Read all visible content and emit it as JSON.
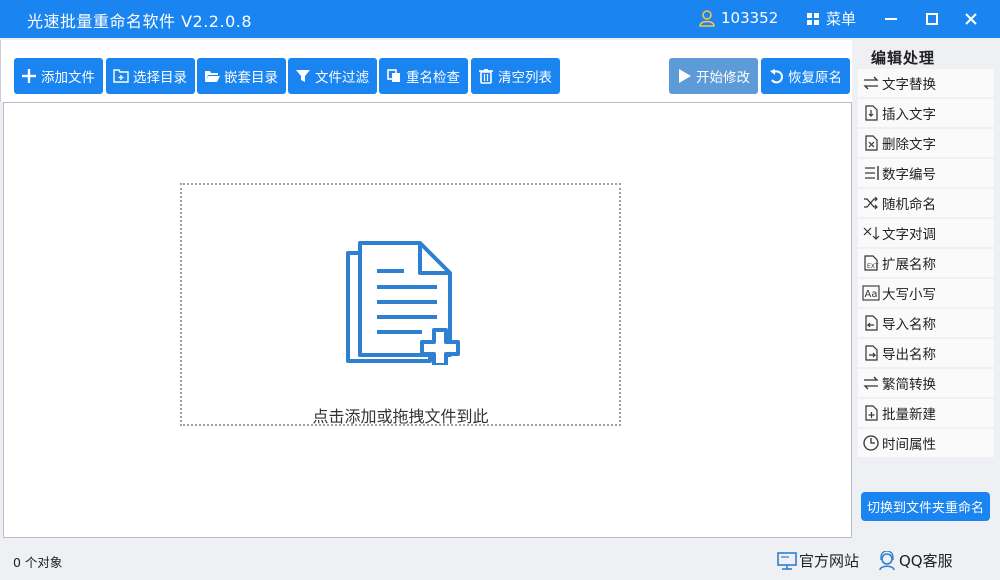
{
  "window": {
    "title": "光速批量重命名软件 V2.2.0.8",
    "user_id": "103352",
    "menu_label": "菜单"
  },
  "toolbar": {
    "add_files": "添加文件",
    "select_dir": "选择目录",
    "nested_dir": "嵌套目录",
    "file_filter": "文件过滤",
    "rename_check": "重名检查",
    "clear_list": "清空列表",
    "start_modify": "开始修改",
    "restore_name": "恢复原名"
  },
  "dropzone": {
    "text": "点击添加或拖拽文件到此"
  },
  "sidebar": {
    "title": "编辑处理",
    "items": [
      {
        "label": "文字替换",
        "icon": "swap-icon"
      },
      {
        "label": "插入文字",
        "icon": "insert-text-icon"
      },
      {
        "label": "删除文字",
        "icon": "delete-text-icon"
      },
      {
        "label": "数字编号",
        "icon": "numbering-icon"
      },
      {
        "label": "随机命名",
        "icon": "shuffle-icon"
      },
      {
        "label": "文字对调",
        "icon": "exchange-icon"
      },
      {
        "label": "扩展名称",
        "icon": "extension-icon"
      },
      {
        "label": "大写小写",
        "icon": "case-icon"
      },
      {
        "label": "导入名称",
        "icon": "import-icon"
      },
      {
        "label": "导出名称",
        "icon": "export-icon"
      },
      {
        "label": "繁简转换",
        "icon": "convert-icon"
      },
      {
        "label": "批量新建",
        "icon": "new-file-icon"
      },
      {
        "label": "时间属性",
        "icon": "clock-icon"
      }
    ],
    "switch_button": "切换到文件夹重命名"
  },
  "status": {
    "object_count": "0 个对象",
    "website": "官方网站",
    "qq_service": "QQ客服"
  },
  "colors": {
    "accent": "#1a84f0",
    "accent_soft": "#5d9ad8",
    "icon_blue": "#2f80d0"
  }
}
